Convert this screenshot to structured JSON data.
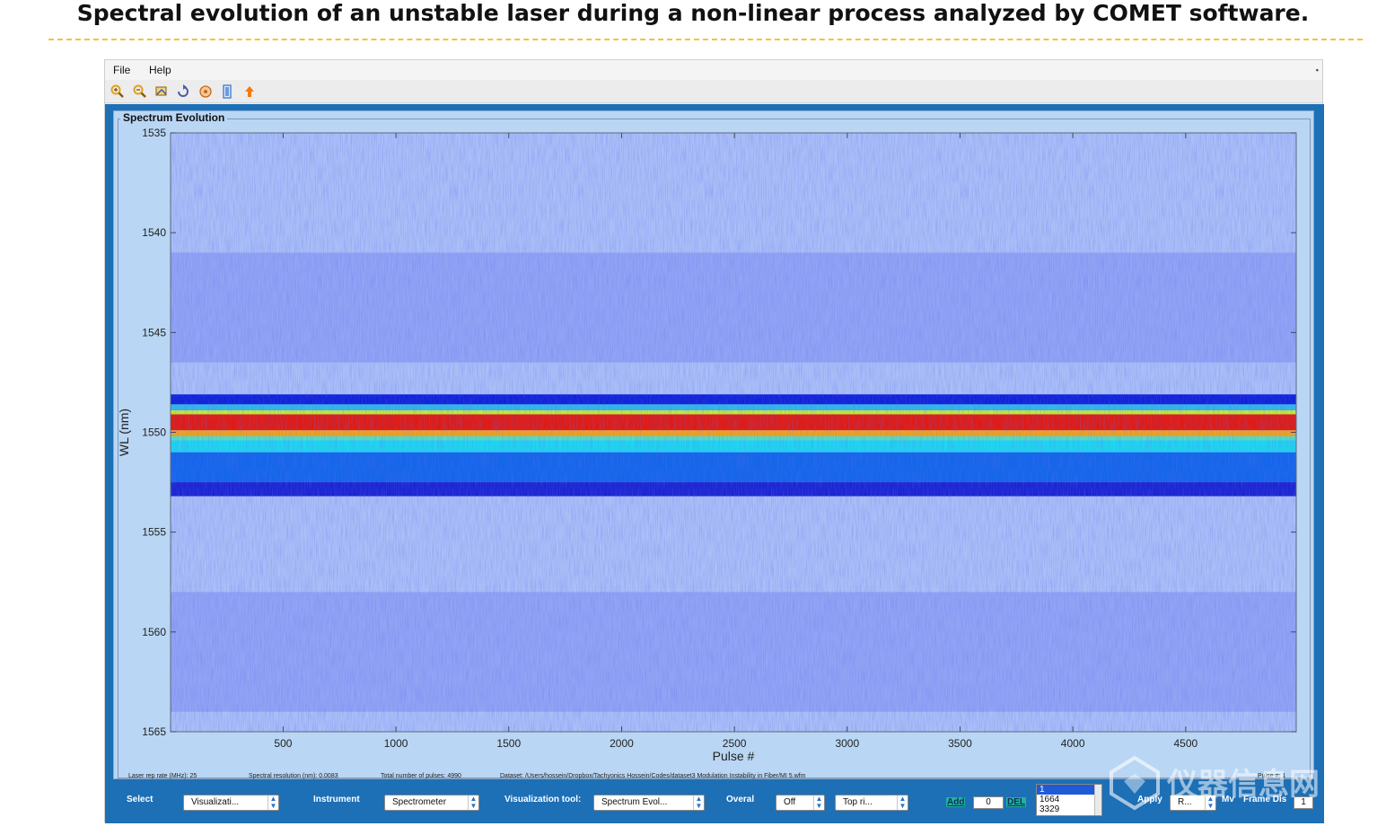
{
  "slide_title": "Spectral evolution of an unstable laser during a non-linear process analyzed by COMET software.",
  "menu": {
    "file": "File",
    "help": "Help",
    "corner": "▪"
  },
  "toolbar": {
    "buttons": [
      {
        "name": "zoom-in-icon",
        "color": "#e0a21b"
      },
      {
        "name": "zoom-out-icon",
        "color": "#e0a21b"
      },
      {
        "name": "pan-icon",
        "color": "#c9891a"
      },
      {
        "name": "rotate-icon",
        "color": "#5a6fae"
      },
      {
        "name": "data-cursor-icon",
        "color": "#d98a2b"
      },
      {
        "name": "insert-colorbar-icon",
        "color": "#4a7fcf"
      },
      {
        "name": "arrow-up-icon",
        "color": "#f27a10"
      }
    ]
  },
  "panel": {
    "title": "Spectrum Evolution"
  },
  "chart_data": {
    "type": "heatmap",
    "xlabel": "Pulse #",
    "ylabel": "WL (nm)",
    "xlim": [
      1,
      4990
    ],
    "ylim": [
      1565,
      1535
    ],
    "xticks": [
      500,
      1000,
      1500,
      2000,
      2500,
      3000,
      3500,
      4000,
      4500
    ],
    "yticks": [
      1535,
      1540,
      1545,
      1550,
      1555,
      1560,
      1565
    ],
    "background_color": "#aabff7",
    "colormap": "jet",
    "bands": [
      {
        "wl_from": 1541.0,
        "wl_to": 1546.5,
        "color": "#7c8ef2",
        "level": 0.18
      },
      {
        "wl_from": 1548.1,
        "wl_to": 1548.6,
        "color": "#1020d8",
        "level": 0.35
      },
      {
        "wl_from": 1548.6,
        "wl_to": 1548.9,
        "color": "#2fb9e8",
        "level": 0.5
      },
      {
        "wl_from": 1548.9,
        "wl_to": 1549.1,
        "color": "#c8e83a",
        "level": 0.7
      },
      {
        "wl_from": 1549.1,
        "wl_to": 1549.9,
        "color": "#e11a12",
        "level": 0.95
      },
      {
        "wl_from": 1549.9,
        "wl_to": 1550.2,
        "color": "#f4a21c",
        "level": 0.8
      },
      {
        "wl_from": 1550.2,
        "wl_to": 1550.4,
        "color": "#52e0c2",
        "level": 0.6
      },
      {
        "wl_from": 1550.4,
        "wl_to": 1551.0,
        "color": "#1fd6f0",
        "level": 0.55
      },
      {
        "wl_from": 1551.0,
        "wl_to": 1552.5,
        "color": "#1466ea",
        "level": 0.45
      },
      {
        "wl_from": 1552.5,
        "wl_to": 1553.2,
        "color": "#1a24d0",
        "level": 0.3
      },
      {
        "wl_from": 1558.0,
        "wl_to": 1564.0,
        "color": "#7c8ef2",
        "level": 0.15
      }
    ]
  },
  "info": {
    "rep_rate": "Laser rep rate (MHz): 25",
    "resolution": "Spectral resolution (nm): 0.0083",
    "total_pulses": "Total number of pulses: 4990",
    "dataset": "Dataset:  /Users/hossein/Dropbox/Tachyonics Hossein/Codes/dataset3 Modulation Instability in Fiber/MI 5.wfm",
    "pulse_label": "Pulse #: 1"
  },
  "controls": {
    "select_label": "Select",
    "select_value": "Visualizati...",
    "instrument_label": "Instrument",
    "instrument_value": "Spectrometer",
    "vis_tool_label": "Visualization tool:",
    "vis_tool_value": "Spectrum Evol...",
    "overal_label": "Overal",
    "overal_value": "Off",
    "position_value": "Top ri...",
    "add_label": "Add",
    "add_value": "0",
    "del_label": "DEL",
    "list_items": [
      "1",
      "1664",
      "3329"
    ],
    "apply_label": "Apply",
    "apply_value": "R...",
    "frame_label": "Frame Dis",
    "frame_value": "1",
    "mv_label": "Mv"
  },
  "watermark": {
    "text": "仪器信息网"
  }
}
